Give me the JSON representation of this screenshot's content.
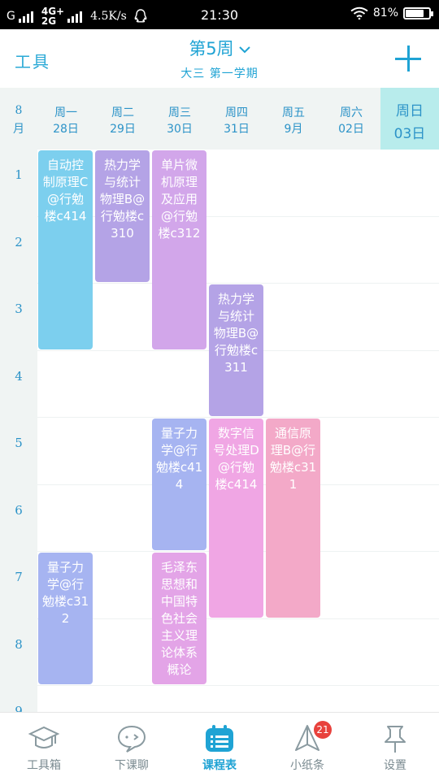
{
  "status_bar": {
    "carrier_g": "G",
    "network_top": "4G+",
    "network_bottom": "2G",
    "speed": "4.5K/s",
    "time": "21:30",
    "battery": "81%",
    "battery_level": 0.81
  },
  "header": {
    "tools_label": "工具",
    "week_title": "第5周",
    "term_label": "大三 第一学期"
  },
  "day_header": {
    "month_top": "8",
    "month_bottom": "月",
    "days": [
      {
        "name": "周一",
        "date": "28日"
      },
      {
        "name": "周二",
        "date": "29日"
      },
      {
        "name": "周三",
        "date": "30日"
      },
      {
        "name": "周四",
        "date": "31日"
      },
      {
        "name": "周五",
        "date": "9月"
      },
      {
        "name": "周六",
        "date": "02日"
      },
      {
        "name": "周日",
        "date": "03日",
        "today": true
      }
    ]
  },
  "periods": [
    "1",
    "2",
    "3",
    "4",
    "5",
    "6",
    "7",
    "8",
    "9"
  ],
  "courses": [
    {
      "text": "自动控制原理C@行勉楼c414",
      "day": 1,
      "start": 1,
      "end": 3,
      "color": "#7ccfee"
    },
    {
      "text": "热力学与统计物理B@行勉楼c310",
      "day": 2,
      "start": 1,
      "end": 2,
      "color": "#b4a3e6"
    },
    {
      "text": "单片微机原理及应用@行勉楼c312",
      "day": 3,
      "start": 1,
      "end": 3,
      "color": "#d2a6ea"
    },
    {
      "text": "热力学与统计物理B@行勉楼c311",
      "day": 4,
      "start": 3,
      "end": 4,
      "color": "#b4a3e6"
    },
    {
      "text": "量子力学@行勉楼c414",
      "day": 3,
      "start": 5,
      "end": 6,
      "color": "#a6b4f1"
    },
    {
      "text": "数字信号处理D@行勉楼c414",
      "day": 4,
      "start": 5,
      "end": 7,
      "color": "#f0a6e4"
    },
    {
      "text": "通信原理B@行勉楼c311",
      "day": 5,
      "start": 5,
      "end": 7,
      "color": "#f3a9c8"
    },
    {
      "text": "量子力学@行勉楼c312",
      "day": 1,
      "start": 7,
      "end": 8,
      "color": "#a6b4f1"
    },
    {
      "text": "毛泽东思想和中国特色社会主义理论体系概论",
      "day": 3,
      "start": 7,
      "end": 8,
      "color": "#e3a4e7"
    }
  ],
  "bottom_nav": [
    {
      "label": "工具箱",
      "icon": "graduation-cap-icon"
    },
    {
      "label": "下课聊",
      "icon": "chat-bubble-icon"
    },
    {
      "label": "课程表",
      "icon": "schedule-icon",
      "active": true
    },
    {
      "label": "小纸条",
      "icon": "paper-plane-icon",
      "badge": "21"
    },
    {
      "label": "设置",
      "icon": "pin-icon"
    }
  ],
  "colors": {
    "accent": "#1fa3d4",
    "today_bg": "#b8ecec",
    "badge": "#e8413c"
  }
}
